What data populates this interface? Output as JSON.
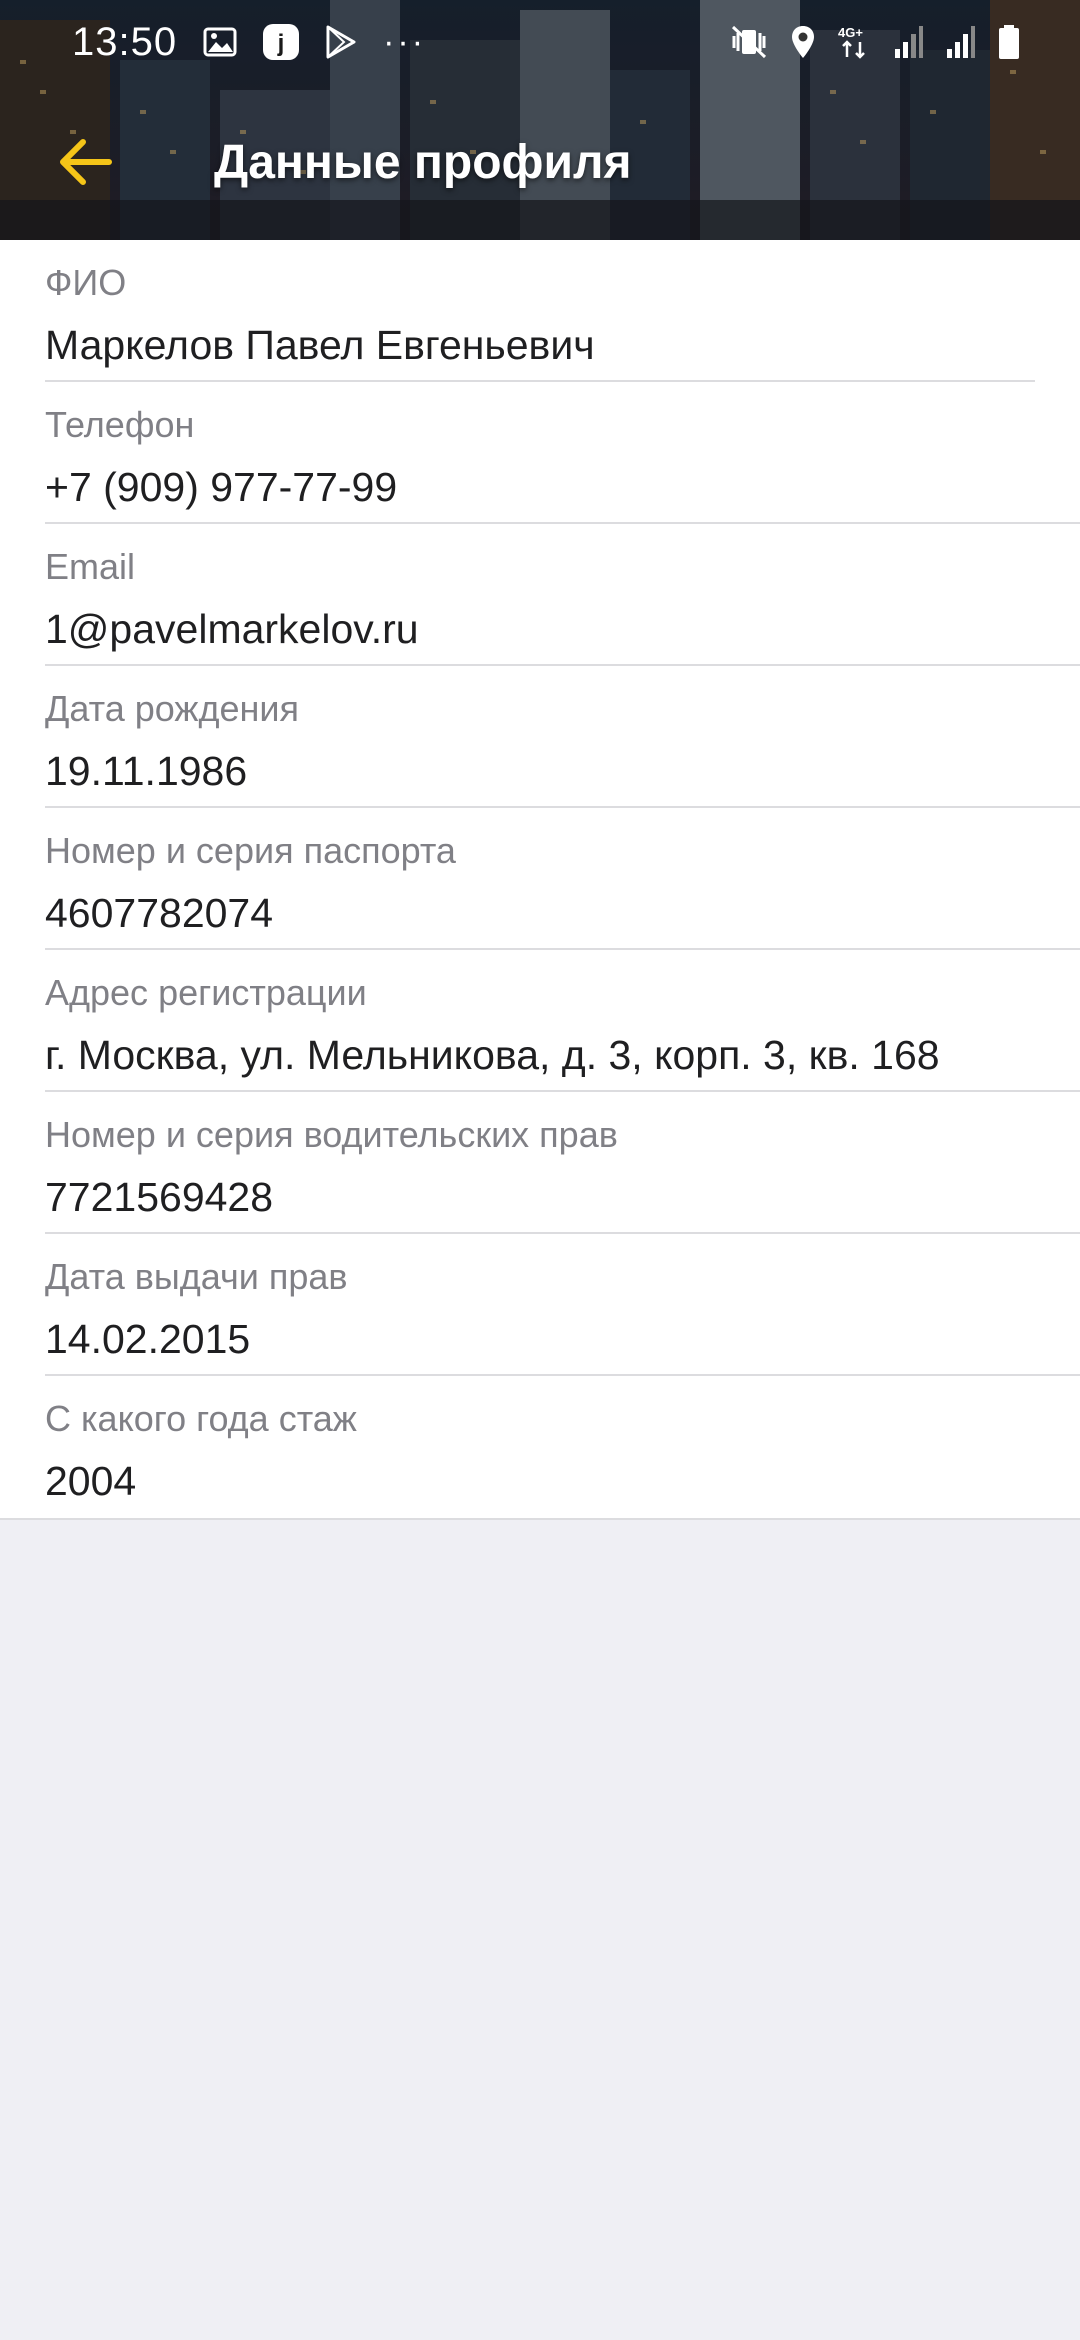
{
  "status_bar": {
    "time": "13:50",
    "icons": [
      "image-icon",
      "app-j-icon",
      "play-store-icon",
      "more-dots-icon",
      "mute-vibrate-icon",
      "location-icon",
      "4g-icon",
      "signal-icon",
      "signal-icon-2",
      "battery-icon"
    ],
    "network": "4G+",
    "more": "···"
  },
  "app_bar": {
    "title": "Данные профиля",
    "back_icon": "arrow-left-icon",
    "accent_color": "#f5c518"
  },
  "fields": [
    {
      "label": "ФИО",
      "value": "Маркелов Павел Евгеньевич"
    },
    {
      "label": "Телефон",
      "value": "+7 (909) 977-77-99"
    },
    {
      "label": "Email",
      "value": "1@pavelmarkelov.ru"
    },
    {
      "label": "Дата рождения",
      "value": "19.11.1986"
    },
    {
      "label": "Номер и серия паспорта",
      "value": "4607782074"
    },
    {
      "label": "Адрес регистрации",
      "value": "г. Москва, ул. Мельникова, д. 3, корп. 3, кв. 168"
    },
    {
      "label": "Номер и серия водительских прав",
      "value": "7721569428"
    },
    {
      "label": "Дата выдачи прав",
      "value": "14.02.2015"
    },
    {
      "label": "С какого года стаж",
      "value": "2004"
    }
  ],
  "colors": {
    "background": "#efeff4",
    "label": "#808086",
    "value": "#1f1f21",
    "divider": "#dcdcdf"
  }
}
